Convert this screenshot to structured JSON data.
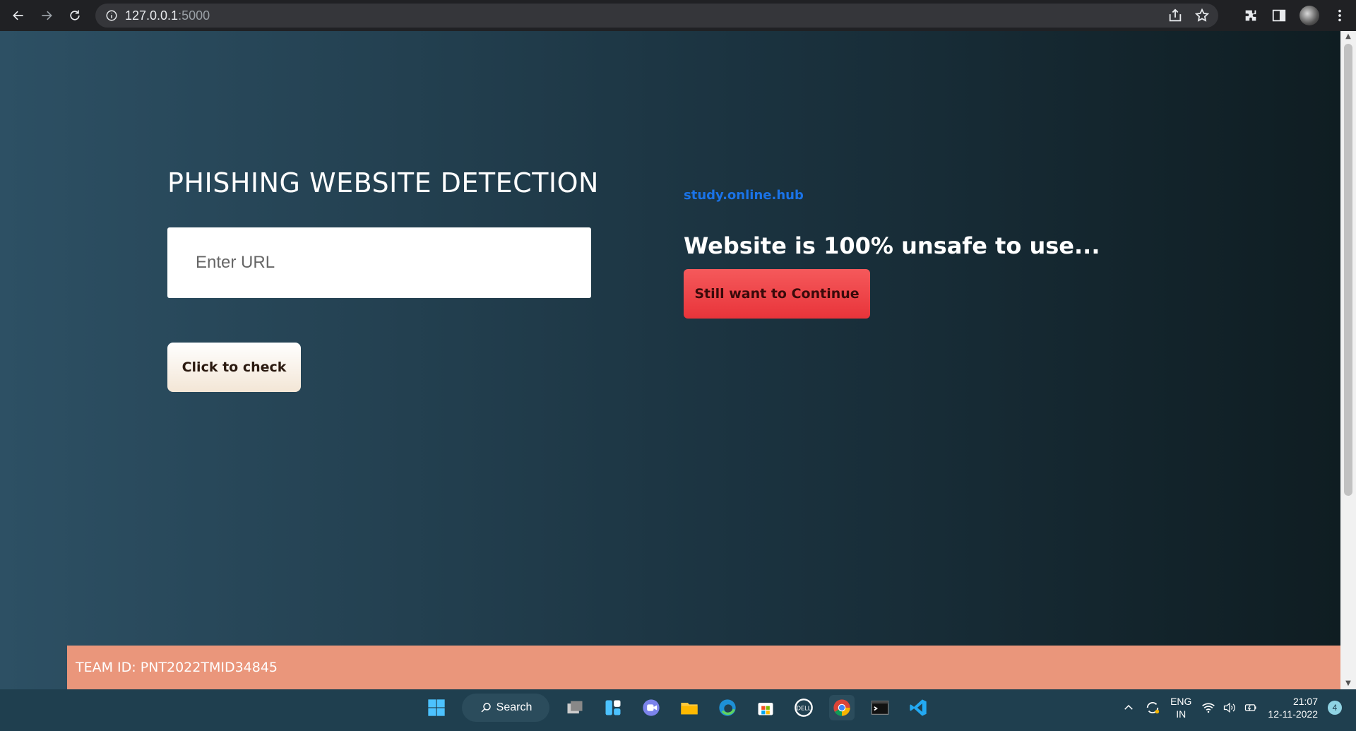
{
  "browser": {
    "url_host": "127.0.0.1",
    "url_port": ":5000"
  },
  "page": {
    "title": "PHISHING WEBSITE DETECTION",
    "url_input_placeholder": "Enter URL",
    "check_button_label": "Click to check",
    "site_link": "study.online.hub",
    "result_text": "Website is 100% unsafe to use...",
    "continue_button_label": "Still want to Continue",
    "footer_text": "TEAM ID: PNT2022TMID34845"
  },
  "taskbar": {
    "search_label": "Search",
    "lang_line1": "ENG",
    "lang_line2": "IN",
    "time": "21:07",
    "date": "12-11-2022",
    "notification_count": "4",
    "apps": [
      "windows-start-icon",
      "task-view-icon",
      "widgets-icon",
      "teams-chat-icon",
      "file-explorer-icon",
      "edge-icon",
      "store-icon",
      "dell-icon",
      "chrome-icon",
      "terminal-icon",
      "vscode-icon"
    ]
  },
  "colors": {
    "accent_link": "#1a73e8",
    "danger_button": "#e8343a",
    "footer_bg": "#ea967b"
  }
}
